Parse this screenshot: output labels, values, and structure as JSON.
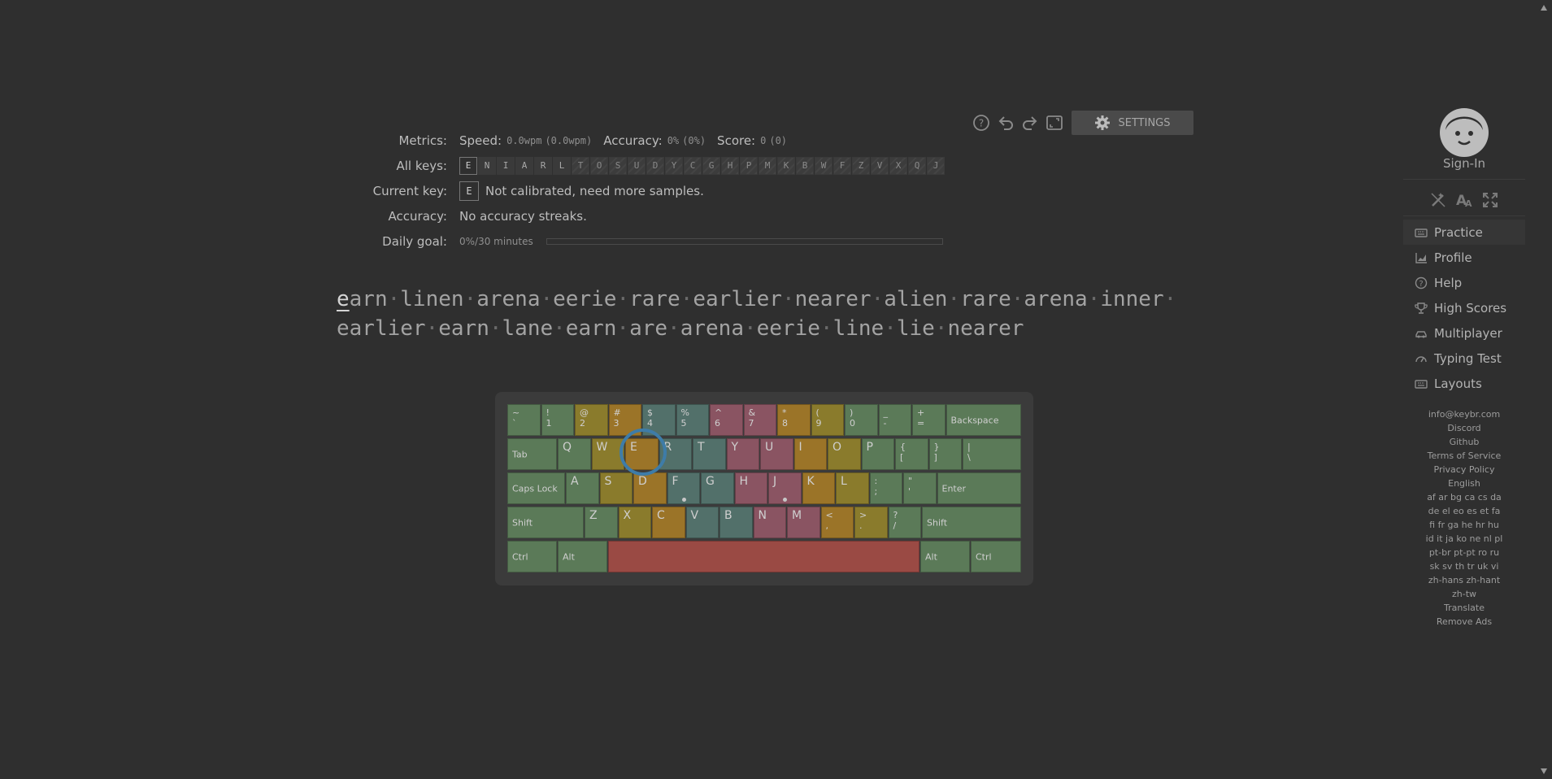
{
  "metrics": {
    "title_label": "Metrics:",
    "speed_label": "Speed:",
    "speed_value": "0.0wpm",
    "speed_value_paren": "(0.0wpm)",
    "accuracy_label": "Accuracy:",
    "accuracy_value": "0%",
    "accuracy_value_paren": "(0%)",
    "score_label": "Score:",
    "score_value": "0",
    "score_value_paren": "(0)",
    "all_keys_label": "All keys:",
    "all_keys": [
      "E",
      "N",
      "I",
      "A",
      "R",
      "L",
      "T",
      "O",
      "S",
      "U",
      "D",
      "Y",
      "C",
      "G",
      "H",
      "P",
      "M",
      "K",
      "B",
      "W",
      "F",
      "Z",
      "V",
      "X",
      "Q",
      "J"
    ],
    "unlocked_count": 6,
    "current_key_label": "Current key:",
    "current_key": "E",
    "current_key_status": "Not calibrated, need more samples.",
    "accuracy_streak_label": "Accuracy:",
    "accuracy_streak_value": "No accuracy streaks.",
    "daily_goal_label": "Daily goal:",
    "daily_goal_value": "0%/30 minutes",
    "daily_goal_progress": 0
  },
  "toolbar": {
    "help_icon": "help-circle-icon",
    "undo_icon": "undo-icon",
    "redo_icon": "redo-icon",
    "fullscreen_icon": "fullscreen-icon",
    "settings_label": "SETTINGS"
  },
  "lesson": {
    "line1": [
      "earn",
      "linen",
      "arena",
      "eerie",
      "rare",
      "earlier",
      "nearer",
      "alien",
      "rare",
      "arena",
      "inner"
    ],
    "line2": [
      "earlier",
      "earn",
      "lane",
      "earn",
      "are",
      "arena",
      "eerie",
      "line",
      "lie",
      "nearer"
    ]
  },
  "keyboard": {
    "row1": [
      [
        "~",
        "`"
      ],
      [
        "!",
        "1"
      ],
      [
        "@",
        "2"
      ],
      [
        "#",
        "3"
      ],
      [
        "$",
        "4"
      ],
      [
        "%",
        "5"
      ],
      [
        "^",
        "6"
      ],
      [
        "&",
        "7"
      ],
      [
        "*",
        "8"
      ],
      [
        "(",
        "9"
      ],
      [
        ")",
        "0"
      ],
      [
        "_",
        "-"
      ],
      [
        "+",
        "="
      ]
    ],
    "backspace": "Backspace",
    "tab": "Tab",
    "row2": [
      "Q",
      "W",
      "E",
      "R",
      "T",
      "Y",
      "U",
      "I",
      "O",
      "P"
    ],
    "row2_sym": [
      [
        "{",
        "["
      ],
      [
        "}",
        "]"
      ],
      [
        "|",
        "\\"
      ]
    ],
    "caps": "Caps Lock",
    "row3": [
      "A",
      "S",
      "D",
      "F",
      "G",
      "H",
      "J",
      "K",
      "L"
    ],
    "row3_sym": [
      [
        ":",
        ";"
      ],
      [
        "\"",
        "'"
      ]
    ],
    "enter": "Enter",
    "shift": "Shift",
    "row4": [
      "Z",
      "X",
      "C",
      "V",
      "B",
      "N",
      "M"
    ],
    "row4_sym": [
      [
        "<",
        ","
      ],
      [
        ">",
        "."
      ],
      [
        "?",
        "/"
      ]
    ],
    "ctrl": "Ctrl",
    "alt": "Alt"
  },
  "sidebar": {
    "sign_in": "Sign-In",
    "nav": [
      {
        "label": "Practice",
        "icon": "keyboard-icon"
      },
      {
        "label": "Profile",
        "icon": "chart-icon"
      },
      {
        "label": "Help",
        "icon": "help-icon"
      },
      {
        "label": "High Scores",
        "icon": "trophy-icon"
      },
      {
        "label": "Multiplayer",
        "icon": "car-icon"
      },
      {
        "label": "Typing Test",
        "icon": "gauge-icon"
      },
      {
        "label": "Layouts",
        "icon": "keyboard-icon"
      }
    ],
    "links": [
      "info@keybr.com",
      "Discord",
      "Github",
      "Terms of Service",
      "Privacy Policy",
      "English",
      "af ar bg ca cs da",
      "de el eo es et fa",
      "fi fr ga he hr hu",
      "id it ja ko ne nl pl",
      "pt-br pt-pt ro ru",
      "sk sv th tr uk vi",
      "zh-hans zh-hant",
      "zh-tw",
      "Translate",
      "Remove Ads"
    ]
  }
}
